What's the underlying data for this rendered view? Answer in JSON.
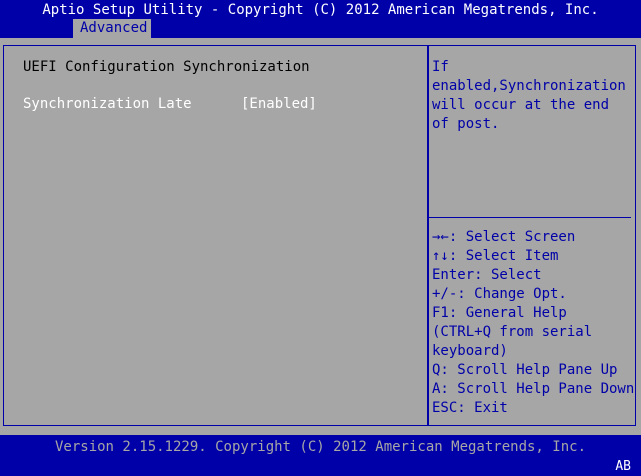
{
  "header": {
    "title": "Aptio Setup Utility - Copyright (C) 2012 American Megatrends, Inc.",
    "active_tab": "Advanced"
  },
  "page": {
    "heading": "UEFI Configuration Synchronization",
    "settings": [
      {
        "label": "Synchronization Late",
        "value": "[Enabled]"
      }
    ]
  },
  "help": {
    "description_lines": [
      "If",
      "enabled,Synchronization",
      "will occur at the end",
      "of post."
    ],
    "keys": [
      "→←: Select Screen",
      "↑↓: Select Item",
      "Enter: Select",
      "+/-: Change Opt.",
      "F1: General Help",
      "(CTRL+Q from serial",
      "keyboard)",
      "Q: Scroll Help Pane Up",
      "A: Scroll Help Pane Down",
      "ESC: Exit"
    ]
  },
  "footer": {
    "version": "Version 2.15.1229. Copyright (C) 2012 American Megatrends, Inc.",
    "indicator": "AB"
  },
  "colors": {
    "bios_blue": "#0000a8",
    "bios_gray": "#a6a6a6",
    "text_white": "#ffffff",
    "text_black": "#000000"
  }
}
